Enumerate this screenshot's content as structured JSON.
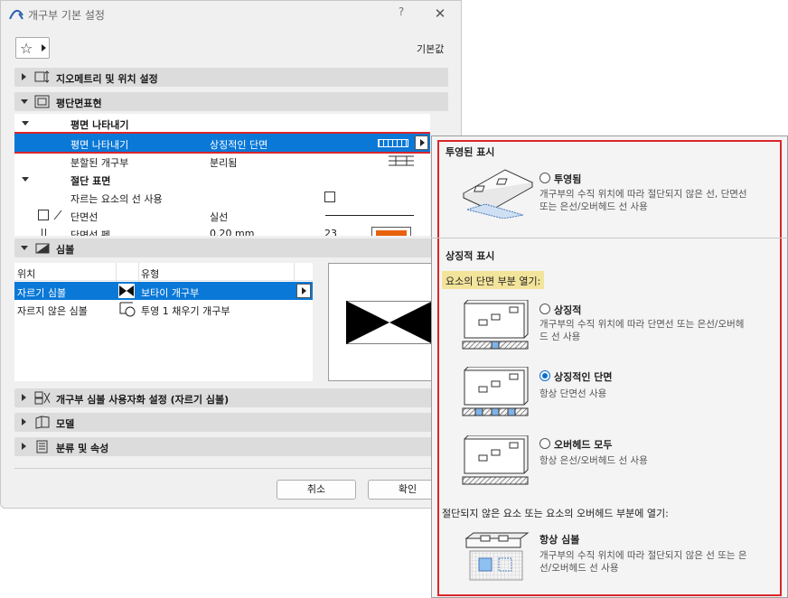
{
  "window": {
    "title": "개구부 기본 설정",
    "help": "?",
    "close": "✕"
  },
  "favorites": {
    "default_label": "기본값"
  },
  "panels": {
    "geometry": "지오메트리 및 위치 설정",
    "floor_plan": "평단면표현",
    "symbol": "심볼",
    "symbol_custom": "개구부 심볼 사용자화 설정 (자르기 심볼)",
    "model": "모델",
    "classification": "분류 및 속성"
  },
  "plan_table": {
    "group1": "평면 나타내기",
    "row1": {
      "label": "평면 나타내기",
      "value": "상징적인 단면"
    },
    "row2": {
      "label": "분할된 개구부",
      "value": "분리됨"
    },
    "group2": "절단 표면",
    "row3": {
      "label": "자르는 요소의 선 사용"
    },
    "row4": {
      "label": "단면선",
      "value": "실선"
    },
    "row5": {
      "label": "단면선 펜",
      "value": "0.20 mm",
      "pen": "23"
    }
  },
  "symbol_table": {
    "headers": {
      "position": "위치",
      "type": "유형"
    },
    "rows": [
      {
        "position": "자르기 심볼",
        "type": "보타이 개구부"
      },
      {
        "position": "자르지 않은 심볼",
        "type": "투영 1 채우기 개구부"
      }
    ]
  },
  "buttons": {
    "cancel": "취소",
    "ok": "확인"
  },
  "popup": {
    "projected_title": "투영된 표시",
    "projected": {
      "label": "투영됨",
      "desc1": "개구부의 수직 위치에 따라 절단되지 않은 선, 단면선",
      "desc2": "또는 은선/오버헤드 선 사용"
    },
    "symbolic_title": "상징적 표시",
    "open_cut_label": "요소의 단면 부분 열기:",
    "symbolic": {
      "label": "상징적",
      "desc1": "개구부의 수직 위치에 따라 단면선 또는 은선/오버헤",
      "desc2": "드 선 사용"
    },
    "symbolic_cut": {
      "label": "상징적인 단면",
      "desc1": "항상 단면선 사용"
    },
    "overhead_all": {
      "label": "오버헤드 모두",
      "desc1": "항상 은선/오버헤드 선 사용"
    },
    "uncut_label": "절단되지 않은 요소 또는 요소의 오버헤드 부분에 열기:",
    "always_symbol": {
      "label": "항상 심볼",
      "desc1": "개구부의 수직 위치에 따라 절단되지 않은 선 또는 은",
      "desc2": "선/오버헤드 선 사용"
    }
  },
  "colors": {
    "selection": "#0a78d7",
    "highlight": "#d9262a",
    "label_bg": "#f3e49b",
    "pen_swatch": "#e8620c"
  }
}
